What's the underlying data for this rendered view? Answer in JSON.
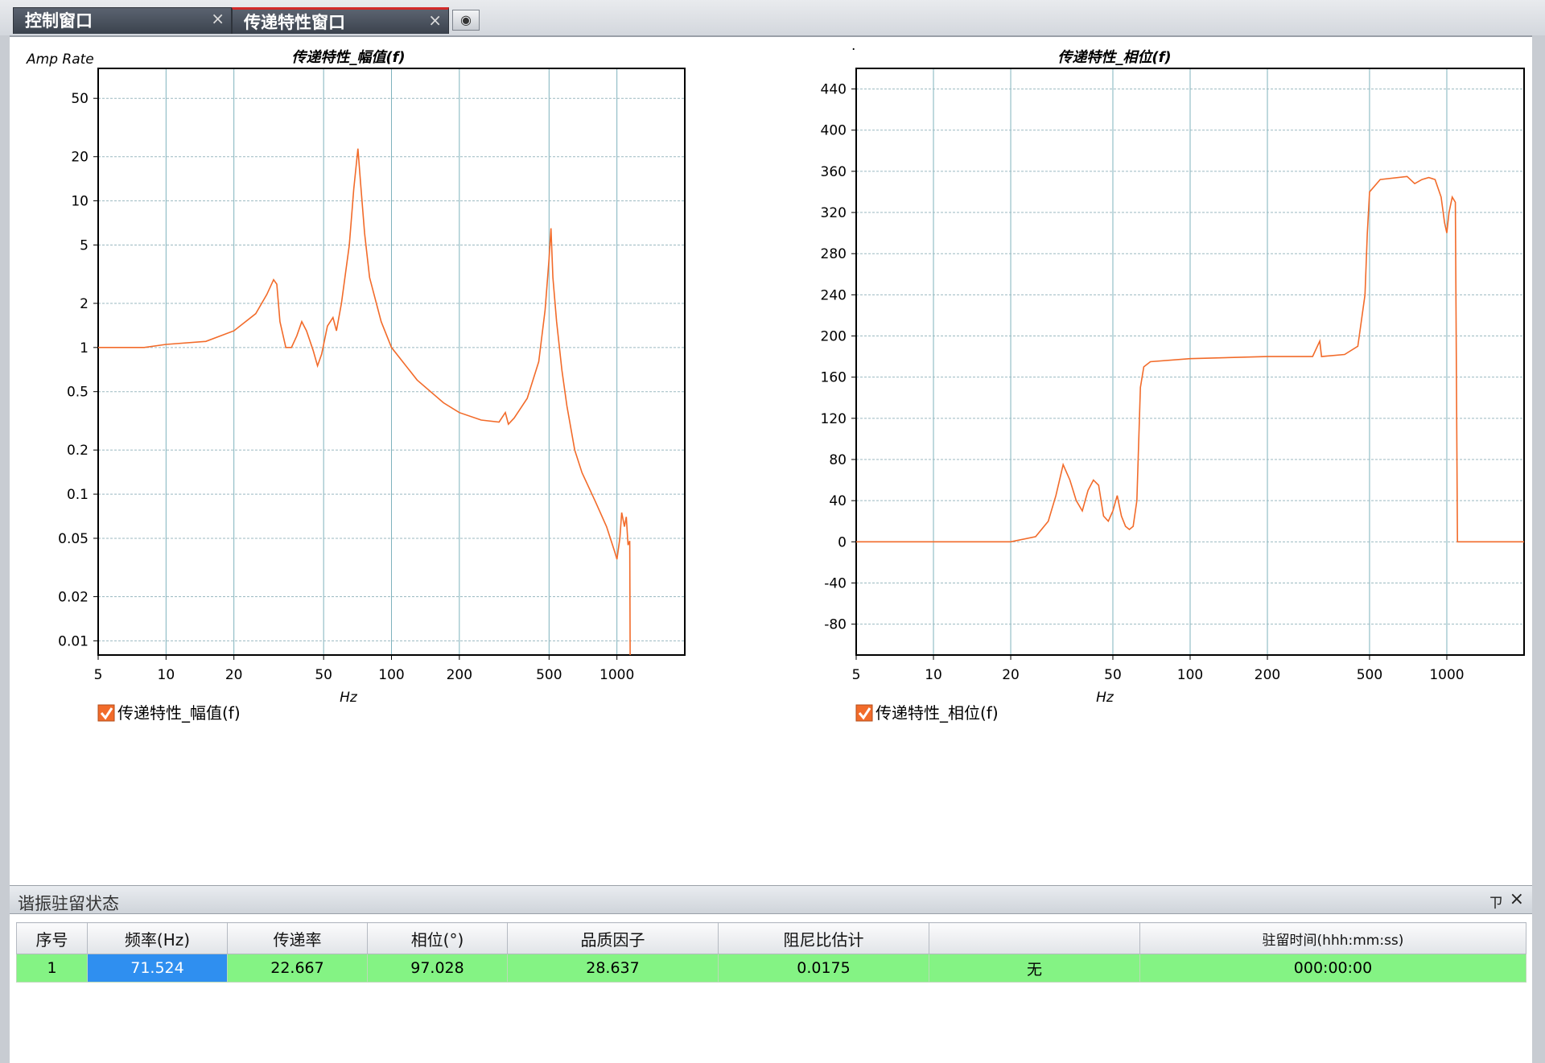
{
  "tabs": [
    {
      "label": "控制窗口",
      "close": "×"
    },
    {
      "label": "传递特性窗口",
      "close": "×"
    }
  ],
  "tab_add_icon": "tab-list-icon",
  "charts": {
    "amplitude": {
      "title": "传递特性_幅值(f)",
      "ylabel": "Amp Rate",
      "xlabel": "Hz",
      "legend": "传递特性_幅值(f)",
      "x_ticks": [
        "5",
        "10",
        "20",
        "50",
        "100",
        "200",
        "500",
        "1000"
      ],
      "y_ticks": [
        "50",
        "20",
        "10",
        "5",
        "2",
        "1",
        "0.5",
        "0.2",
        "0.1",
        "0.05",
        "0.02",
        "0.01"
      ]
    },
    "phase": {
      "title": "传递特性_相位(f)",
      "ylabel": ".",
      "xlabel": "Hz",
      "legend": "传递特性_相位(f)",
      "x_ticks": [
        "5",
        "10",
        "20",
        "50",
        "100",
        "200",
        "500",
        "1000"
      ],
      "y_ticks": [
        "440",
        "400",
        "360",
        "320",
        "280",
        "240",
        "200",
        "160",
        "120",
        "80",
        "40",
        "0",
        "-40",
        "-80"
      ]
    }
  },
  "chart_data": [
    {
      "type": "line",
      "title": "传递特性_幅值(f)",
      "xlabel": "Hz",
      "ylabel": "Amp Rate",
      "x_scale": "log",
      "y_scale": "log",
      "xlim": [
        5,
        2000
      ],
      "ylim": [
        0.008,
        80
      ],
      "grid": true,
      "legend_placement": "bottom-left",
      "series": [
        {
          "name": "传递特性_幅值(f)",
          "color": "#f26b2a",
          "points": [
            [
              5,
              1.0
            ],
            [
              8,
              1.0
            ],
            [
              10,
              1.05
            ],
            [
              15,
              1.1
            ],
            [
              20,
              1.3
            ],
            [
              25,
              1.7
            ],
            [
              28,
              2.3
            ],
            [
              30,
              2.9
            ],
            [
              31,
              2.7
            ],
            [
              32,
              1.5
            ],
            [
              34,
              1.0
            ],
            [
              36,
              1.0
            ],
            [
              38,
              1.2
            ],
            [
              40,
              1.5
            ],
            [
              42,
              1.3
            ],
            [
              45,
              0.95
            ],
            [
              47,
              0.75
            ],
            [
              49,
              0.9
            ],
            [
              52,
              1.4
            ],
            [
              55,
              1.6
            ],
            [
              57,
              1.3
            ],
            [
              60,
              2.0
            ],
            [
              65,
              5.0
            ],
            [
              68,
              12
            ],
            [
              71,
              22.7
            ],
            [
              73,
              13
            ],
            [
              76,
              6
            ],
            [
              80,
              3
            ],
            [
              90,
              1.5
            ],
            [
              100,
              1.0
            ],
            [
              130,
              0.6
            ],
            [
              170,
              0.42
            ],
            [
              200,
              0.36
            ],
            [
              250,
              0.32
            ],
            [
              300,
              0.31
            ],
            [
              320,
              0.36
            ],
            [
              330,
              0.3
            ],
            [
              350,
              0.33
            ],
            [
              400,
              0.45
            ],
            [
              450,
              0.8
            ],
            [
              480,
              1.8
            ],
            [
              500,
              4
            ],
            [
              510,
              6.5
            ],
            [
              520,
              3
            ],
            [
              540,
              1.5
            ],
            [
              570,
              0.7
            ],
            [
              600,
              0.4
            ],
            [
              650,
              0.2
            ],
            [
              700,
              0.14
            ],
            [
              800,
              0.09
            ],
            [
              900,
              0.06
            ],
            [
              980,
              0.04
            ],
            [
              1000,
              0.036
            ],
            [
              1030,
              0.05
            ],
            [
              1050,
              0.075
            ],
            [
              1080,
              0.06
            ],
            [
              1100,
              0.07
            ],
            [
              1120,
              0.045
            ],
            [
              1140,
              0.048
            ],
            [
              1145,
              0.008
            ]
          ]
        }
      ]
    },
    {
      "type": "line",
      "title": "传递特性_相位(f)",
      "xlabel": "Hz",
      "ylabel": "",
      "x_scale": "log",
      "xlim": [
        5,
        2000
      ],
      "ylim": [
        -110,
        460
      ],
      "grid": true,
      "legend_placement": "bottom-left",
      "series": [
        {
          "name": "传递特性_相位(f)",
          "color": "#f26b2a",
          "points": [
            [
              5,
              0
            ],
            [
              10,
              0
            ],
            [
              20,
              0
            ],
            [
              25,
              5
            ],
            [
              28,
              20
            ],
            [
              30,
              45
            ],
            [
              32,
              75
            ],
            [
              34,
              60
            ],
            [
              36,
              40
            ],
            [
              38,
              30
            ],
            [
              40,
              50
            ],
            [
              42,
              60
            ],
            [
              44,
              55
            ],
            [
              46,
              25
            ],
            [
              48,
              20
            ],
            [
              50,
              30
            ],
            [
              52,
              45
            ],
            [
              54,
              25
            ],
            [
              56,
              15
            ],
            [
              58,
              12
            ],
            [
              60,
              15
            ],
            [
              62,
              40
            ],
            [
              64,
              150
            ],
            [
              66,
              170
            ],
            [
              70,
              175
            ],
            [
              100,
              178
            ],
            [
              200,
              180
            ],
            [
              300,
              180
            ],
            [
              320,
              195
            ],
            [
              325,
              180
            ],
            [
              400,
              182
            ],
            [
              450,
              190
            ],
            [
              480,
              240
            ],
            [
              490,
              300
            ],
            [
              500,
              340
            ],
            [
              550,
              352
            ],
            [
              700,
              355
            ],
            [
              750,
              348
            ],
            [
              800,
              352
            ],
            [
              850,
              354
            ],
            [
              900,
              352
            ],
            [
              950,
              335
            ],
            [
              980,
              310
            ],
            [
              1000,
              300
            ],
            [
              1020,
              320
            ],
            [
              1050,
              335
            ],
            [
              1080,
              330
            ],
            [
              1100,
              0
            ],
            [
              1500,
              0
            ],
            [
              2000,
              0
            ]
          ]
        }
      ]
    }
  ],
  "dock": {
    "title": "谐振驻留状态",
    "pin": "ㄗ",
    "close": "×",
    "columns": [
      "序号",
      "频率(Hz)",
      "传递率",
      "相位(°)",
      "品质因子",
      "阻尼比估计",
      "",
      "驻留时间(hhh:mm:ss)"
    ],
    "rows": [
      [
        "1",
        "71.524",
        "22.667",
        "97.028",
        "28.637",
        "0.0175",
        "无",
        "000:00:00"
      ]
    ]
  }
}
